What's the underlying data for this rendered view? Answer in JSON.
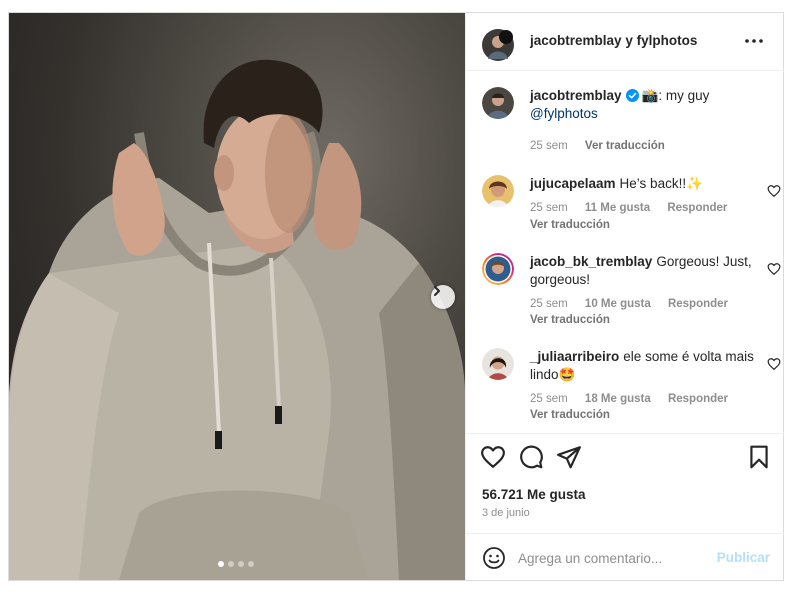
{
  "post": {
    "carousel": {
      "current_index": 1,
      "total": 4
    },
    "header": {
      "user1": "jacobtremblay",
      "connector": "y",
      "user2": "fylphotos"
    },
    "caption": {
      "username": "jacobtremblay",
      "emoji": "📸",
      "text": ": my guy",
      "mention": "@fylphotos",
      "time": "25 sem",
      "translate": "Ver traducción"
    },
    "comments": [
      {
        "username": "jujucapelaam",
        "text": "He’s back!!✨",
        "time": "25 sem",
        "likes": "11 Me gusta",
        "reply": "Responder",
        "translate": "Ver traducción"
      },
      {
        "username": "jacob_bk_tremblay",
        "text": "Gorgeous! Just, gorgeous!",
        "time": "25 sem",
        "likes": "10 Me gusta",
        "reply": "Responder",
        "translate": "Ver traducción"
      },
      {
        "username": "_juliaarribeiro",
        "text": "ele some é volta mais lindo🤩",
        "time": "25 sem",
        "likes": "18 Me gusta",
        "reply": "Responder",
        "translate": "Ver traducción"
      }
    ],
    "likes_count": "56.721 Me gusta",
    "date": "3 de junio",
    "add_comment": {
      "placeholder": "Agrega un comentario...",
      "publish": "Publicar"
    }
  },
  "colors": {
    "verified": "#0095f6",
    "publish_disabled": "#b2dffc",
    "secondary_text": "#8e8e8e"
  },
  "icons": [
    "more-options-icon",
    "verified-badge-icon",
    "heart-icon",
    "comment-icon",
    "share-icon",
    "save-icon",
    "emoji-icon",
    "chevron-right-icon"
  ]
}
